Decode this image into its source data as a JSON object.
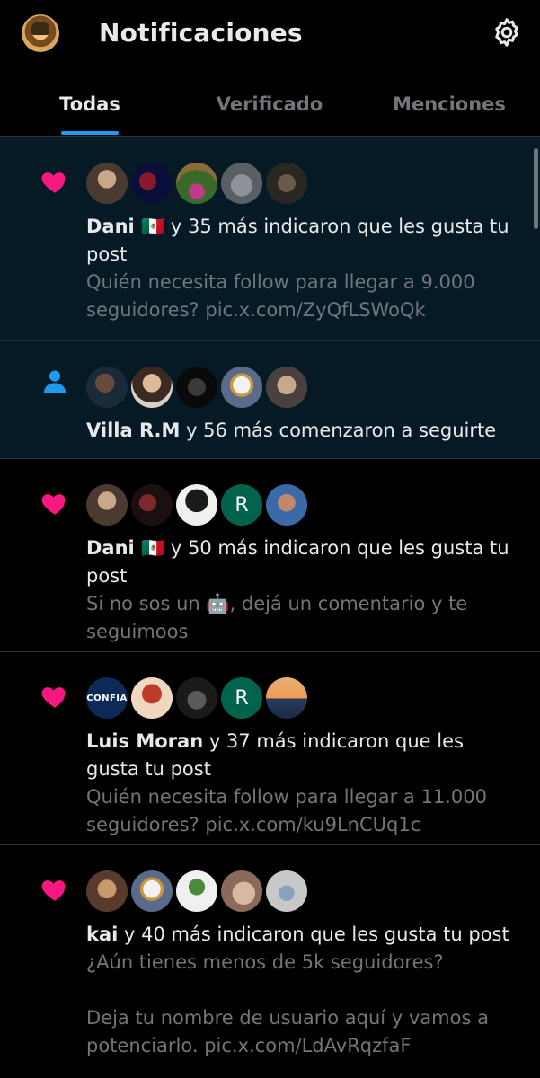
{
  "header": {
    "title": "Notificaciones",
    "avatar_icon": "profile-avatar",
    "settings_icon": "gear-icon"
  },
  "tabs": [
    {
      "label": "Todas",
      "active": true
    },
    {
      "label": "Verificado",
      "active": false
    },
    {
      "label": "Menciones",
      "active": false
    }
  ],
  "colors": {
    "accent": "#1d9bf0",
    "like": "#f91880",
    "muted": "#71767b",
    "text": "#e7e9ea",
    "unread_bg": "#061a26"
  },
  "notifications": [
    {
      "type": "like",
      "actor": "Dani 🇲🇽",
      "action": " y 35 más indicaron que les gusta tu post",
      "preview": [
        "Quién necesita follow para llegar a 9.000 seguidores? pic.x.com/ZyQfLSWoQk"
      ]
    },
    {
      "type": "follow",
      "actor": "Villa R.M",
      "action": " y 56 más comenzaron a seguirte",
      "preview": []
    },
    {
      "type": "like",
      "actor": "Dani 🇲🇽",
      "action": " y 50 más indicaron que les gusta tu post",
      "preview": [
        "Si no sos un 🤖, dejá un comentario y te seguimoos"
      ],
      "avatar_letter": "R"
    },
    {
      "type": "like",
      "actor": "Luis Moran",
      "action": " y 37 más indicaron que les gusta tu post",
      "preview": [
        "Quién necesita follow para llegar a 11.000 seguidores? pic.x.com/ku9LnCUq1c"
      ],
      "avatar_letter": "R",
      "avatar_badge": "CONFIA"
    },
    {
      "type": "like",
      "actor": "kai",
      "action": " y 40 más indicaron que les gusta tu post",
      "preview": [
        "¿Aún tienes menos de 5k seguidores?",
        "Deja tu nombre de usuario aquí y vamos a potenciarlo. pic.x.com/LdAvRqzfaF"
      ]
    }
  ]
}
